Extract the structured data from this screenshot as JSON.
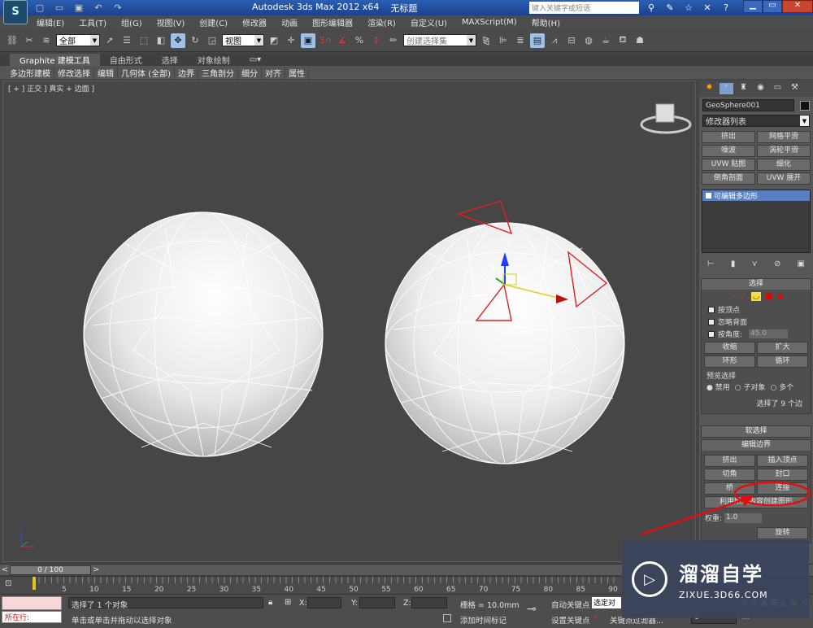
{
  "title": {
    "app": "Autodesk 3ds Max  2012 x64",
    "doc": "无标题",
    "search_placeholder": "键入关键字或短语"
  },
  "menu": [
    "编辑(E)",
    "工具(T)",
    "组(G)",
    "视图(V)",
    "创建(C)",
    "修改器",
    "动画",
    "图形编辑器",
    "渲染(R)",
    "自定义(U)",
    "MAXScript(M)",
    "帮助(H)"
  ],
  "toolbar": {
    "filter": "全部",
    "refcoord": "视图",
    "selset": "创建选择集",
    "snap_num": "3",
    "percent": "%"
  },
  "ribbon_tabs": [
    "Graphite 建模工具",
    "自由形式",
    "选择",
    "对象绘制"
  ],
  "ribbon_items": [
    "多边形建模",
    "修改选择",
    "编辑",
    "几何体 (全部)",
    "边界",
    "三角剖分",
    "细分",
    "对齐",
    "属性"
  ],
  "viewport": {
    "label": "[ + ] 正交 ] 真实 + 边面 ]"
  },
  "panel": {
    "object_name": "GeoSphere001",
    "modifier_list": "修改器列表",
    "buttons": [
      "挤出",
      "网格平滑",
      "噪波",
      "涡轮平滑",
      "UVW 贴图",
      "细化",
      "倒角剖面",
      "UVW 展开"
    ],
    "stack_item": "可编辑多边形",
    "selection": {
      "title": "选择",
      "by_vertex": "按顶点",
      "ignore_back": "忽略背面",
      "by_angle": "按角度:",
      "angle": "45.0",
      "shrink": "收缩",
      "grow": "扩大",
      "ring": "环形",
      "loop": "循环",
      "preview": "预览选择",
      "disable": "禁用",
      "subobj": "子对象",
      "multi": "多个",
      "status": "选择了 9 个边"
    },
    "soft_sel": "软选择",
    "edit_border": {
      "title": "编辑边界",
      "extrude": "挤出",
      "insert_vertex": "插入顶点",
      "chamfer": "切角",
      "cap": "封口",
      "bridge": "桥",
      "connect": "连接",
      "create_shape": "利用所选内容创建图形",
      "weight": "权重:",
      "weight_val": "1.0",
      "rotate": "旋转"
    }
  },
  "timeline": {
    "frame": "0 / 100",
    "ticks": [
      "5",
      "10",
      "15",
      "20",
      "25",
      "30",
      "35",
      "40",
      "45",
      "50",
      "55",
      "60",
      "65",
      "70",
      "75",
      "80",
      "85",
      "90"
    ]
  },
  "status": {
    "mode": "所在行:",
    "selected": "选择了 1 个对象",
    "hint": "单击或单击并拖动以选择对象",
    "x_label": "X:",
    "y_label": "Y:",
    "z_label": "Z:",
    "grid": "栅格 = 10.0mm",
    "add_time_tag": "添加时间标记",
    "auto_key": "自动关键点",
    "selected_obj": "选定对象",
    "set_key": "设置关键点",
    "key_filter": "关键点过滤器...",
    "frame_val": "0"
  },
  "watermark": {
    "cn": "溜溜自学",
    "url": "ZIXUE.3D66.COM"
  },
  "colors": {
    "accent": "#9fc0e8",
    "selection_red": "#e02020",
    "annotation_red": "#e01010"
  }
}
